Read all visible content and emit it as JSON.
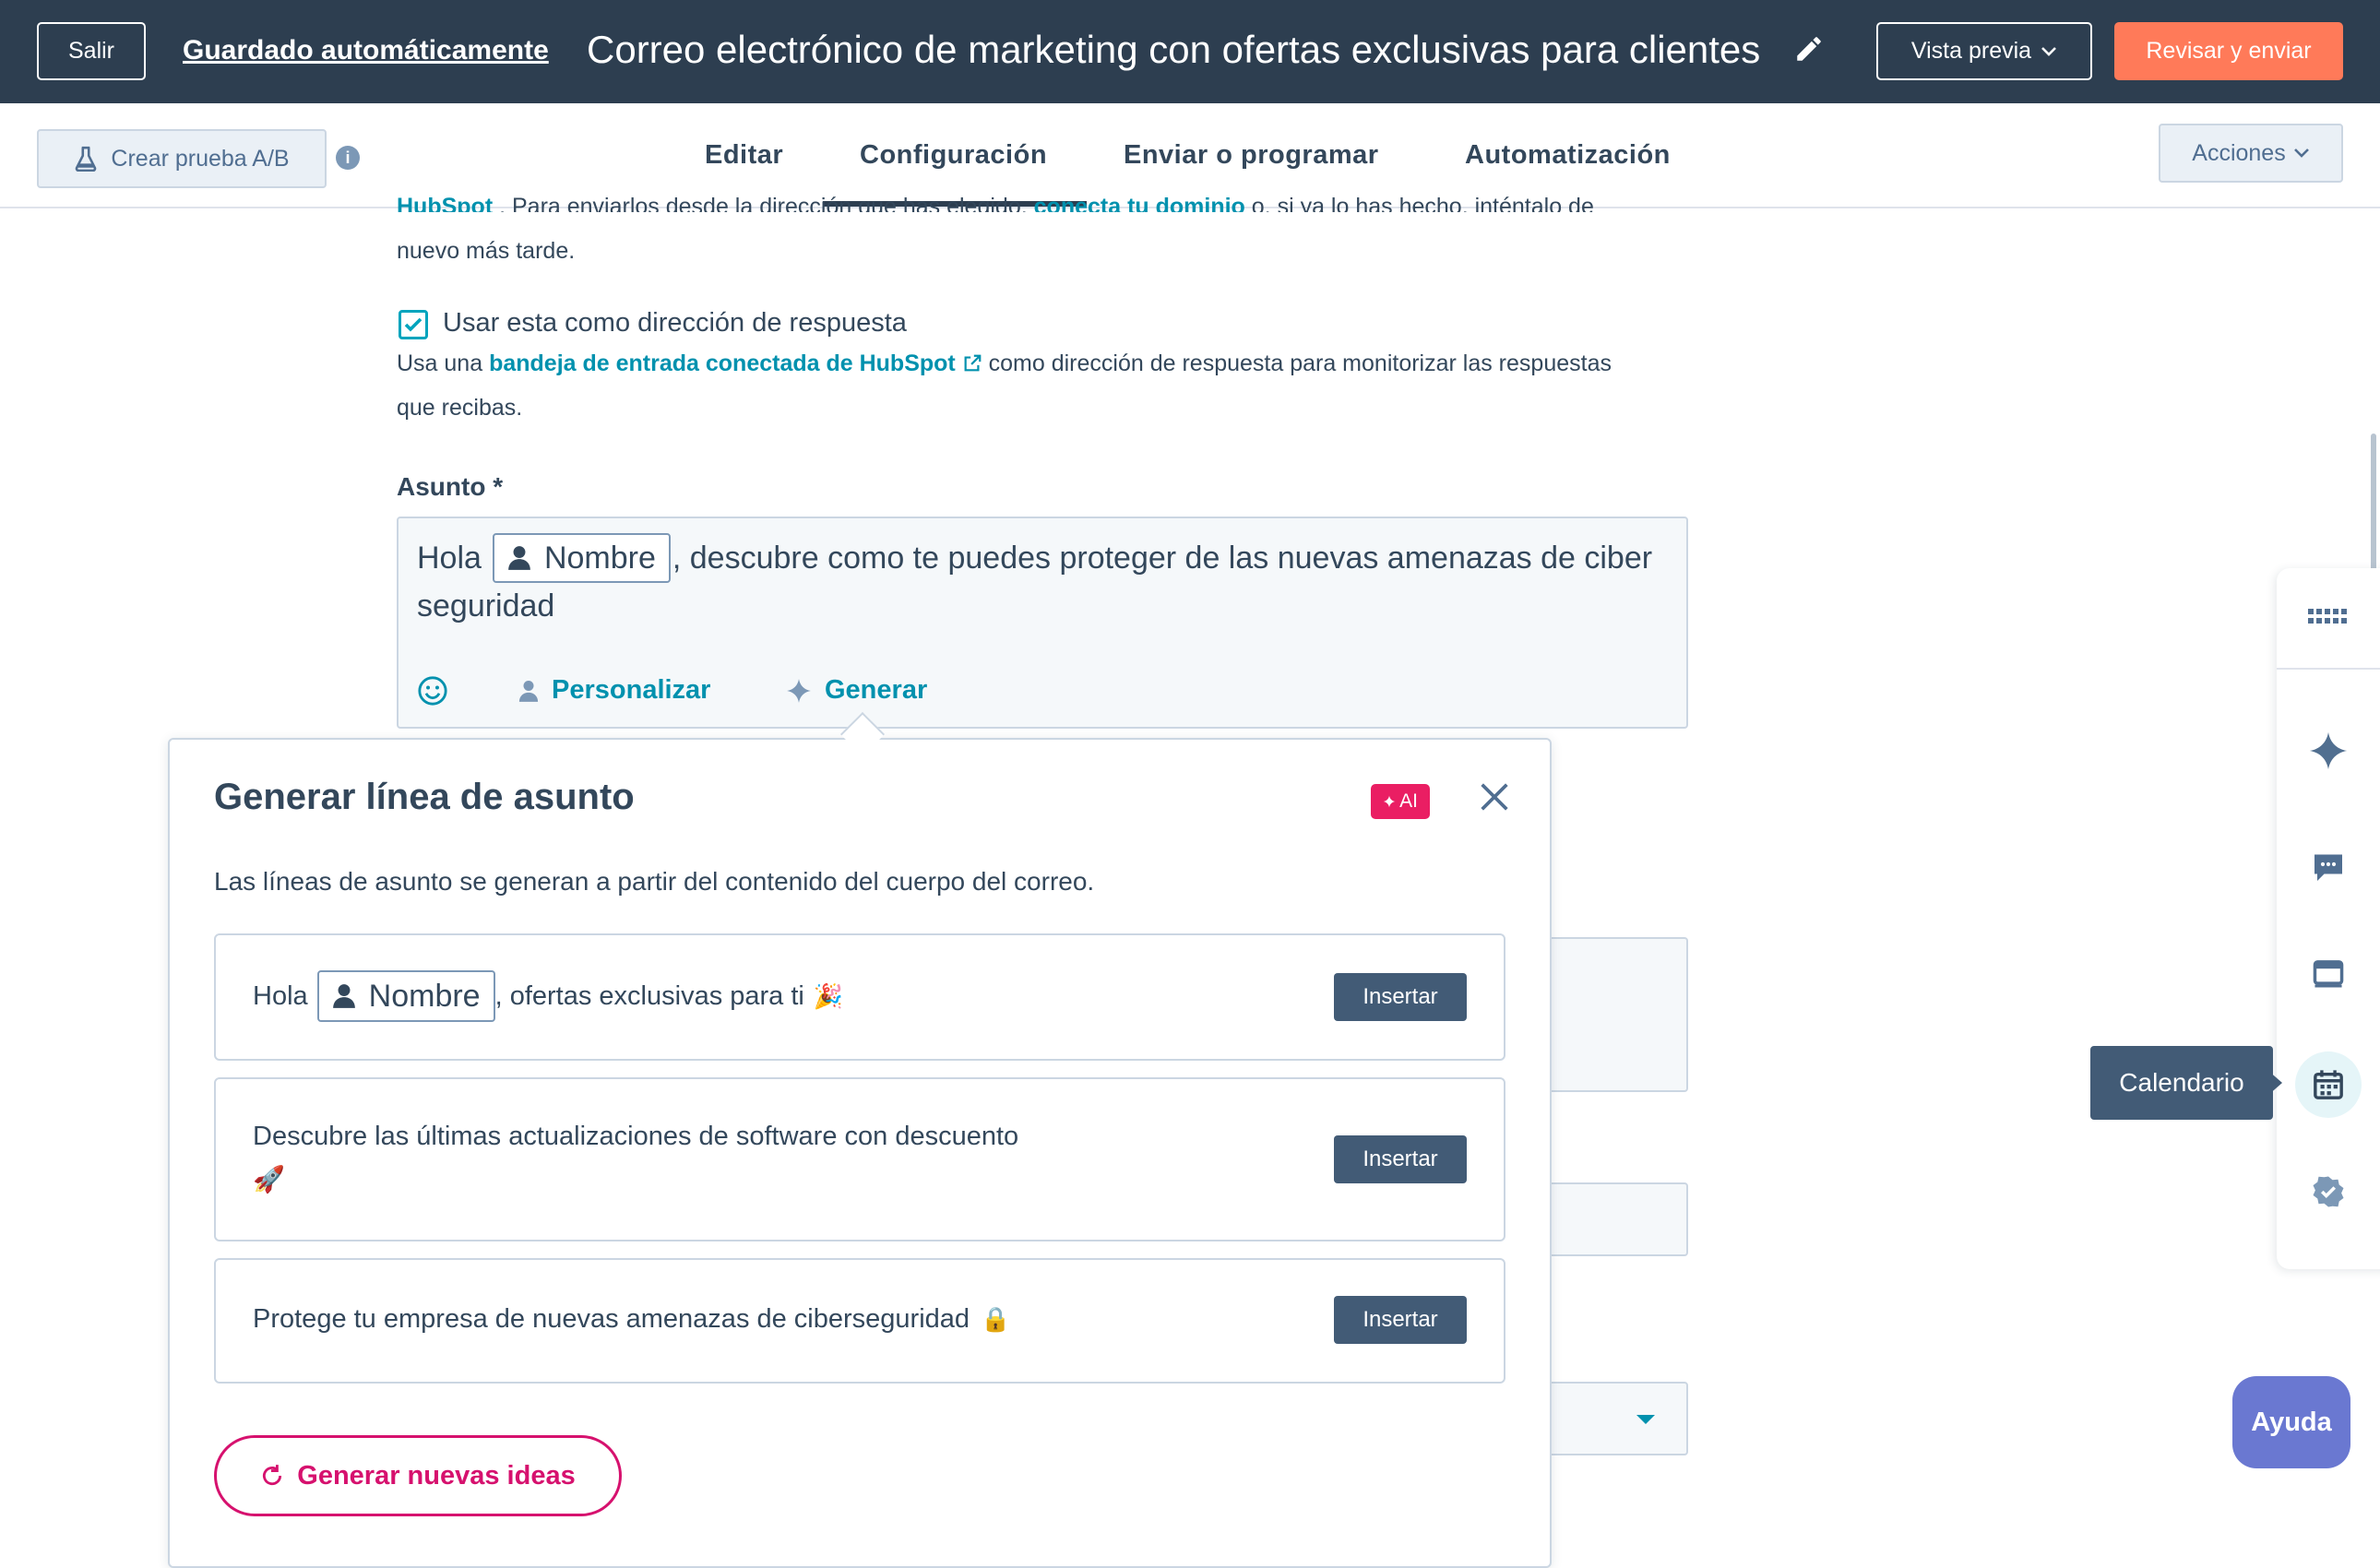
{
  "topbar": {
    "exit_label": "Salir",
    "autosave_label": "Guardado automáticamente",
    "email_title": "Correo electrónico de marketing con ofertas exclusivas para clientes",
    "preview_label": "Vista previa",
    "review_label": "Revisar y enviar"
  },
  "tabbar": {
    "ab_test_label": "Crear prueba A/B",
    "tabs": [
      {
        "label": "Editar"
      },
      {
        "label": "Configuración",
        "active": true
      },
      {
        "label": "Enviar o programar"
      },
      {
        "label": "Automatización"
      }
    ],
    "actions_label": "Acciones"
  },
  "content": {
    "cut_line_start": "HubSpot",
    "cut_line_mid": ". Para enviarlos desde la dirección que has elegido,",
    "cut_line_link": "conecta tu dominio",
    "cut_line_end": "o, si ya lo has hecho, inténtalo de",
    "cut_line2": "nuevo más tarde.",
    "reply_checkbox_label": "Usar esta como dirección de respuesta",
    "reply_help_start": "Usa una",
    "reply_help_link": "bandeja de entrada conectada de HubSpot",
    "reply_help_end": "como dirección de respuesta para monitorizar las respuestas",
    "reply_help_line2": "que recibas.",
    "subject_label": "Asunto *",
    "subject_prefix": "Hola",
    "subject_token": "Nombre",
    "subject_suffix": ", descubre como te puedes proteger de las nuevas amenazas de ciber",
    "subject_line2": "seguridad",
    "personalize_label": "Personalizar",
    "generate_label": "Generar"
  },
  "popover": {
    "title": "Generar línea de asunto",
    "ai_badge": "AI",
    "description": "Las líneas de asunto se generan a partir del contenido del cuerpo del correo.",
    "suggestions": [
      {
        "prefix": "Hola",
        "token": "Nombre",
        "text": ", ofertas exclusivas para ti",
        "emoji": "🎉"
      },
      {
        "text": "Descubre las últimas actualizaciones de software con descuento",
        "emoji": "🚀"
      },
      {
        "text": "Protege tu empresa de nuevas amenazas de ciberseguridad",
        "emoji": "🔒"
      }
    ],
    "insert_label": "Insertar",
    "generate_more_label": "Generar nuevas ideas"
  },
  "sidebar": {
    "icons": [
      "apps-grid-icon",
      "sparkle-icon",
      "chat-icon",
      "browser-icon",
      "calendar-icon",
      "verified-icon"
    ],
    "tooltip": "Calendario"
  },
  "help_label": "Ayuda",
  "colors": {
    "header_bg": "#2d3e50",
    "primary_orange": "#ff7a59",
    "link_teal": "#0091ae",
    "ai_pink": "#ea1e63",
    "insert_btn": "#425b76",
    "help_purple": "#6a78d1"
  }
}
